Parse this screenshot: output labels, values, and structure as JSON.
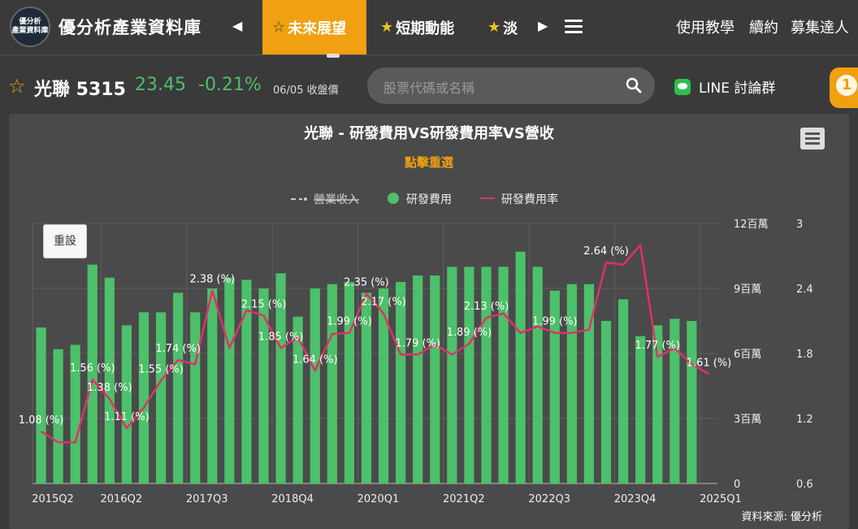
{
  "header": {
    "logo_line1": "優分析",
    "logo_line2": "產業資料庫",
    "site_title": "優分析產業資料庫",
    "tabs": [
      {
        "label": "未來展望",
        "active": true
      },
      {
        "label": "短期動能",
        "active": false
      },
      {
        "label": "淡",
        "active": false
      }
    ],
    "nav_links": [
      "使用教學",
      "續約",
      "募集達人"
    ]
  },
  "stock": {
    "name_code": "光聯 5315",
    "price": "23.45",
    "change": "-0.21%",
    "date_label": "06/05 收盤價"
  },
  "search": {
    "placeholder": "股票代碼或名稱"
  },
  "line_group": {
    "label": "LINE 討論群"
  },
  "badge": {
    "count": "1"
  },
  "chart_ui": {
    "reset_label": "重設",
    "source_label": "資料來源: 優分析"
  },
  "chart_data": {
    "type": "bar",
    "title": "光聯 - 研發費用VS研發費用率VS營收",
    "subtitle": "點擊重選",
    "legend": [
      {
        "name": "營業收入",
        "hidden": true
      },
      {
        "name": "研發費用",
        "color": "#4cc06a"
      },
      {
        "name": "研發費用率",
        "color": "#e0306a"
      }
    ],
    "x_tick_labels": [
      "2015Q2",
      "2016Q2",
      "2017Q3",
      "2018Q4",
      "2020Q1",
      "2021Q2",
      "2022Q3",
      "2023Q4",
      "2025Q1"
    ],
    "left_axis": {
      "ticks": [
        "0",
        "3百萬",
        "6百萬",
        "9百萬",
        "12百萬"
      ],
      "ylim": [
        0,
        12000000
      ]
    },
    "right_axis": {
      "ticks": [
        "0.6",
        "1.2",
        "1.8",
        "2.4",
        "3"
      ],
      "ylim": [
        0.6,
        3.0
      ]
    },
    "categories": [
      "2015Q2",
      "2015Q3",
      "2015Q4",
      "2016Q1",
      "2016Q2",
      "2016Q3",
      "2016Q4",
      "2017Q1",
      "2017Q2",
      "2017Q3",
      "2017Q4",
      "2018Q1",
      "2018Q2",
      "2018Q3",
      "2018Q4",
      "2019Q1",
      "2019Q2",
      "2019Q3",
      "2019Q4",
      "2020Q1",
      "2020Q2",
      "2020Q3",
      "2020Q4",
      "2021Q1",
      "2021Q2",
      "2021Q3",
      "2021Q4",
      "2022Q1",
      "2022Q2",
      "2022Q3",
      "2022Q4",
      "2023Q1",
      "2023Q2",
      "2023Q3",
      "2023Q4",
      "2024Q1",
      "2024Q2",
      "2024Q3",
      "2024Q4",
      "2025Q1"
    ],
    "series": [
      {
        "name": "研發費用",
        "type": "bar",
        "color": "#4cc06a",
        "values": [
          7.2,
          6.2,
          6.4,
          10.1,
          9.5,
          7.3,
          7.9,
          7.9,
          8.8,
          7.9,
          9.0,
          9.5,
          9.4,
          9.0,
          9.7,
          7.7,
          9.0,
          9.2,
          9.3,
          8.8,
          9.0,
          9.3,
          9.6,
          9.6,
          10.0,
          10.0,
          10.0,
          10.0,
          10.7,
          10.0,
          8.9,
          9.2,
          9.2,
          7.5,
          8.5,
          6.8,
          7.3,
          7.6,
          7.5
        ]
      },
      {
        "name": "研發費用率",
        "type": "line",
        "color": "#e0306a",
        "values": [
          1.08,
          0.98,
          0.98,
          1.56,
          1.38,
          1.11,
          1.3,
          1.55,
          1.74,
          1.7,
          2.38,
          1.85,
          2.2,
          2.15,
          1.85,
          1.95,
          1.64,
          1.98,
          1.99,
          2.35,
          2.17,
          1.79,
          1.79,
          1.88,
          1.79,
          1.89,
          2.13,
          2.17,
          1.99,
          2.05,
          1.99,
          1.99,
          2.02,
          2.64,
          2.62,
          2.8,
          1.77,
          1.85,
          1.7,
          1.61
        ]
      }
    ],
    "data_labels": [
      {
        "index": 0,
        "text": "1.08 (%)"
      },
      {
        "index": 3,
        "text": "1.56 (%)"
      },
      {
        "index": 4,
        "text": "1.38 (%)"
      },
      {
        "index": 5,
        "text": "1.11 (%)"
      },
      {
        "index": 7,
        "text": "1.55 (%)"
      },
      {
        "index": 8,
        "text": "1.74 (%)"
      },
      {
        "index": 10,
        "text": "2.38 (%)"
      },
      {
        "index": 13,
        "text": "2.15 (%)"
      },
      {
        "index": 14,
        "text": "1.85 (%)"
      },
      {
        "index": 16,
        "text": "1.64 (%)"
      },
      {
        "index": 18,
        "text": "1.99 (%)"
      },
      {
        "index": 19,
        "text": "2.35 (%)"
      },
      {
        "index": 20,
        "text": "2.17 (%)"
      },
      {
        "index": 22,
        "text": "1.79 (%)"
      },
      {
        "index": 25,
        "text": "1.89 (%)"
      },
      {
        "index": 26,
        "text": "2.13 (%)"
      },
      {
        "index": 30,
        "text": "1.99 (%)"
      },
      {
        "index": 33,
        "text": "2.64 (%)"
      },
      {
        "index": 36,
        "text": "1.77 (%)"
      },
      {
        "index": 39,
        "text": "1.61 (%)"
      }
    ]
  }
}
